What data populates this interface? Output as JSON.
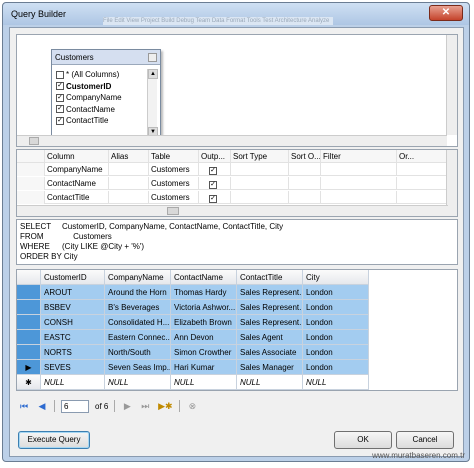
{
  "window": {
    "title": "Query Builder",
    "close_glyph": "✕",
    "bg_text": "File   Edit   View   Project   Build   Debug   Team   Data   Format   Tools   Test   Architecture   Analyze"
  },
  "diagram": {
    "table_name": "Customers",
    "columns": [
      {
        "label": "* (All Columns)",
        "checked": false,
        "bold": false
      },
      {
        "label": "CustomerID",
        "checked": true,
        "bold": true
      },
      {
        "label": "CompanyName",
        "checked": true,
        "bold": false
      },
      {
        "label": "ContactName",
        "checked": true,
        "bold": false
      },
      {
        "label": "ContactTitle",
        "checked": true,
        "bold": false
      }
    ]
  },
  "criteria": {
    "headers": [
      "Column",
      "Alias",
      "Table",
      "Outp...",
      "Sort Type",
      "Sort O...",
      "Filter",
      "Or..."
    ],
    "rows": [
      {
        "column": "CompanyName",
        "alias": "",
        "table": "Customers",
        "output": true
      },
      {
        "column": "ContactName",
        "alias": "",
        "table": "Customers",
        "output": true
      },
      {
        "column": "ContactTitle",
        "alias": "",
        "table": "Customers",
        "output": true
      }
    ]
  },
  "sql": [
    {
      "kw": "SELECT",
      "rest": "CustomerID, CompanyName, ContactName, ContactTitle, City"
    },
    {
      "kw": "FROM",
      "rest": "     Customers"
    },
    {
      "kw": "WHERE",
      "rest": "(City LIKE @City + '%')"
    },
    {
      "kw": "ORDER BY City",
      "rest": ""
    }
  ],
  "results": {
    "headers": [
      "CustomerID",
      "CompanyName",
      "ContactName",
      "ContactTitle",
      "City"
    ],
    "rows": [
      [
        "AROUT",
        "Around the Horn",
        "Thomas Hardy",
        "Sales Represent...",
        "London"
      ],
      [
        "BSBEV",
        "B's Beverages",
        "Victoria Ashwor...",
        "Sales Represent...",
        "London"
      ],
      [
        "CONSH",
        "Consolidated H...",
        "Elizabeth Brown",
        "Sales Represent...",
        "London"
      ],
      [
        "EASTC",
        "Eastern Connec...",
        "Ann Devon",
        "Sales Agent",
        "London"
      ],
      [
        "NORTS",
        "North/South",
        "Simon Crowther",
        "Sales Associate",
        "London"
      ],
      [
        "SEVES",
        "Seven Seas Imp...",
        "Hari Kumar",
        "Sales Manager",
        "London"
      ]
    ],
    "new_row": [
      "NULL",
      "NULL",
      "NULL",
      "NULL",
      "NULL"
    ],
    "new_row_marker": "✱",
    "current_row_marker": "▶"
  },
  "navigator": {
    "first": "⏮",
    "prev": "◀",
    "position": "6",
    "of": "of 6",
    "next": "▶",
    "last": "⏭",
    "add": "▶✱",
    "delete": "⊗"
  },
  "buttons": {
    "execute": "Execute Query",
    "ok": "OK",
    "cancel": "Cancel"
  },
  "watermark": "www.muratbaseren.com.tr"
}
